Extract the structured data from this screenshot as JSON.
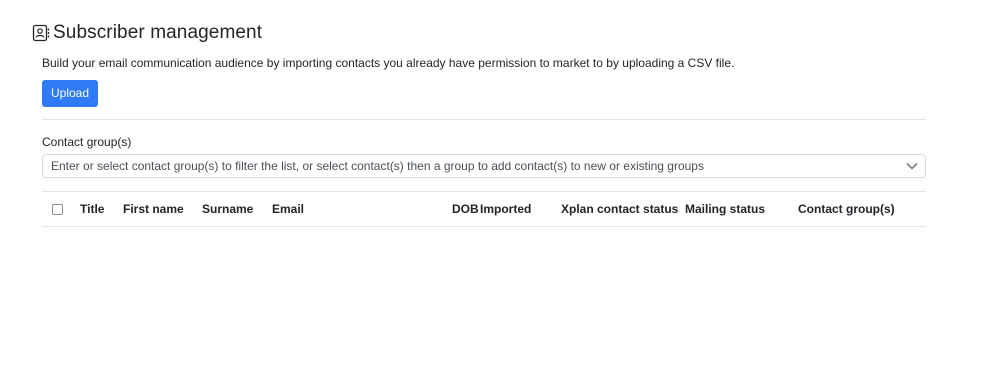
{
  "header": {
    "icon": "contact-card-icon",
    "title": "Subscriber management"
  },
  "description": "Build your email communication audience by importing contacts you already have permission to market to by uploading a CSV file.",
  "upload_label": "Upload",
  "contact_group": {
    "label": "Contact group(s)",
    "placeholder": "Enter or select contact group(s) to filter the list, or select contact(s) then a group to add contact(s) to new or existing groups",
    "icon": "chevron-down-icon"
  },
  "table": {
    "select_all_checked": false,
    "columns": [
      "Title",
      "First name",
      "Surname",
      "Email",
      "DOB",
      "Imported",
      "Xplan contact status",
      "Mailing status",
      "Contact group(s)"
    ],
    "rows": []
  },
  "colors": {
    "accent": "#2f7bf6",
    "text": "#212529",
    "border": "#e5e5e5"
  }
}
